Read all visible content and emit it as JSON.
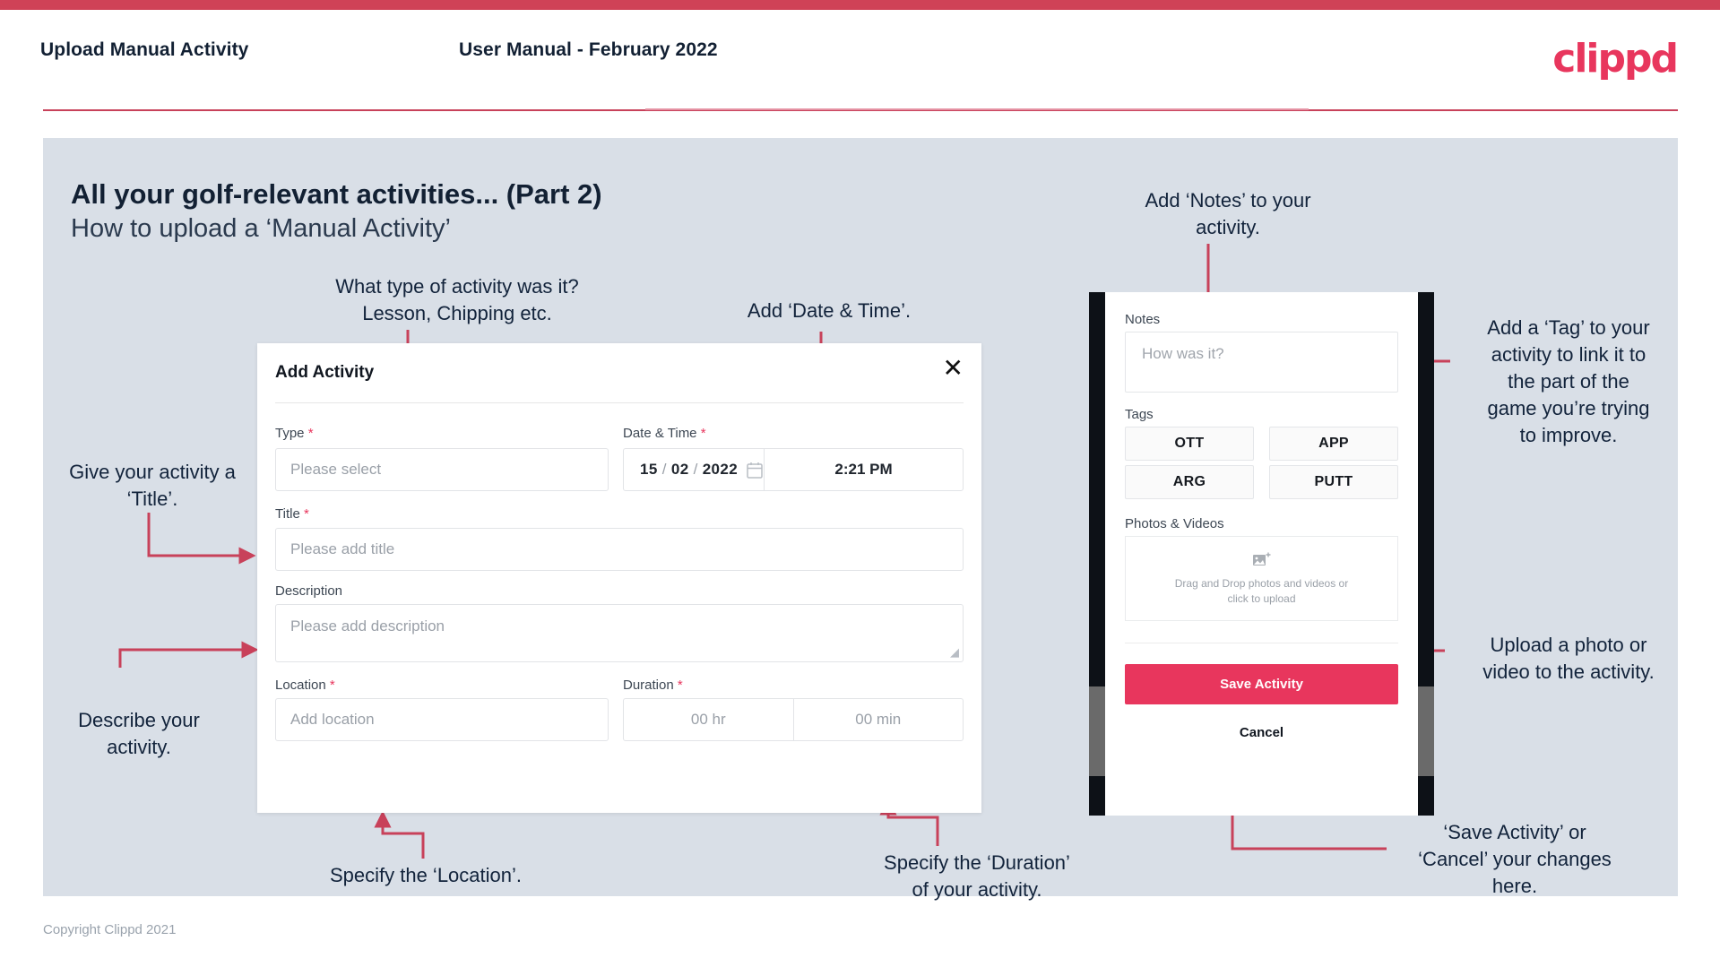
{
  "header": {
    "title": "Upload Manual Activity",
    "subtitle": "User Manual - February 2022",
    "logo": "clippd"
  },
  "slide": {
    "title": "All your golf-relevant activities... (Part 2)",
    "subtitle": "How to upload a ‘Manual Activity’"
  },
  "annotations": {
    "type": "What type of activity was it?\nLesson, Chipping etc.",
    "datetime": "Add ‘Date & Time’.",
    "title_field": "Give your activity a\n‘Title’.",
    "description": "Describe your\nactivity.",
    "location": "Specify the ‘Location’.",
    "duration": "Specify the ‘Duration’\nof your activity.",
    "notes": "Add ‘Notes’ to your\nactivity.",
    "tags": "Add a ‘Tag’ to your\nactivity to link it to\nthe part of the\ngame you’re trying\nto improve.",
    "upload": "Upload a photo or\nvideo to the activity.",
    "save": "‘Save Activity’ or\n‘Cancel’ your changes\nhere."
  },
  "dialog": {
    "title": "Add Activity",
    "close_icon": "close-icon",
    "fields": {
      "type": {
        "label": "Type",
        "required": "*",
        "placeholder": "Please select",
        "caret_icon": "chevron-down-icon"
      },
      "datetime": {
        "label": "Date & Time",
        "required": "*",
        "day": "15",
        "month": "02",
        "year": "2022",
        "sep": "/",
        "calendar_icon": "calendar-icon",
        "time": "2:21 PM"
      },
      "title": {
        "label": "Title",
        "required": "*",
        "placeholder": "Please add title"
      },
      "description": {
        "label": "Description",
        "required": "",
        "placeholder": "Please add description"
      },
      "location": {
        "label": "Location",
        "required": "*",
        "placeholder": "Add location"
      },
      "duration": {
        "label": "Duration",
        "required": "*",
        "hours_placeholder": "00 hr",
        "minutes_placeholder": "00 min"
      }
    }
  },
  "phone": {
    "notes": {
      "label": "Notes",
      "placeholder": "How was it?"
    },
    "tags": {
      "label": "Tags",
      "items": [
        "OTT",
        "APP",
        "ARG",
        "PUTT"
      ]
    },
    "photos": {
      "label": "Photos & Videos",
      "icon": "add-image-icon",
      "line1": "Drag and Drop photos and videos or",
      "line2": "click to upload"
    },
    "save_label": "Save Activity",
    "cancel_label": "Cancel"
  },
  "footer": {
    "copyright": "Copyright Clippd 2021"
  },
  "colors": {
    "brand_pink": "#e8365d",
    "arrow_red": "#c8415a",
    "slide_bg": "#d9dfe7",
    "navy_text": "#122033"
  }
}
